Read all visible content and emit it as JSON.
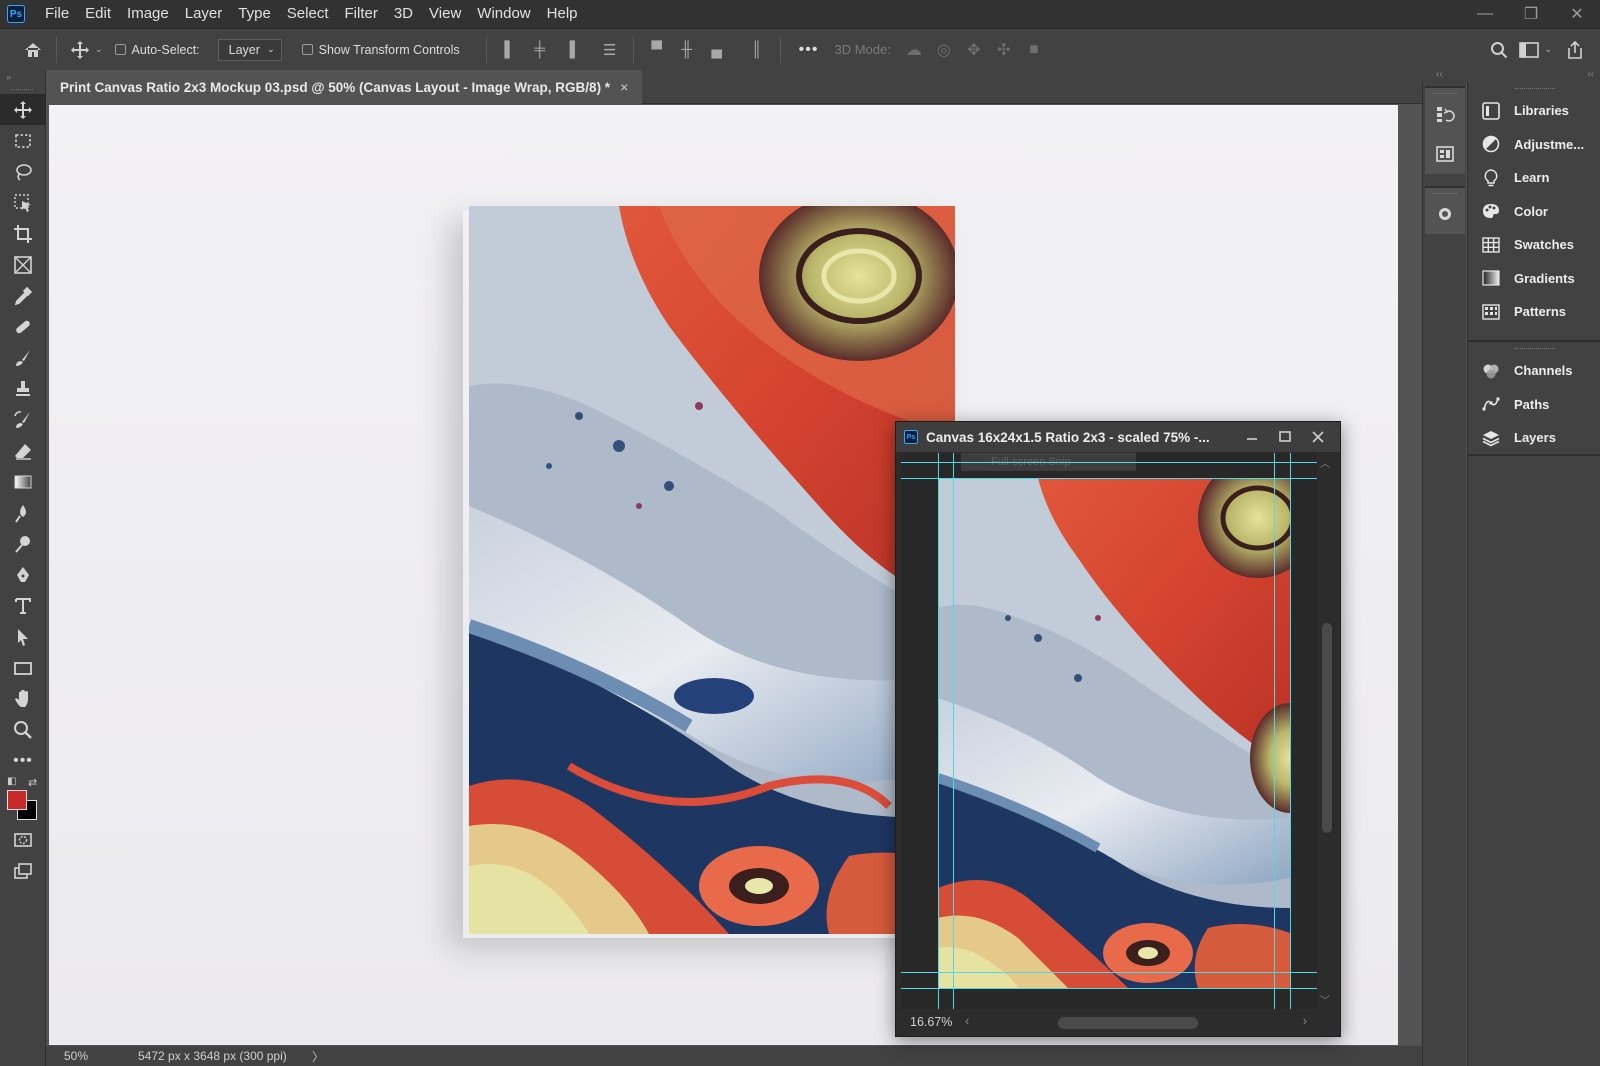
{
  "app": {
    "logo_text": "Ps"
  },
  "menu": [
    "File",
    "Edit",
    "Image",
    "Layer",
    "Type",
    "Select",
    "Filter",
    "3D",
    "View",
    "Window",
    "Help"
  ],
  "window_controls": {
    "minimize": "—",
    "restore": "❐",
    "close": "✕"
  },
  "options_bar": {
    "auto_select_label": "Auto-Select:",
    "auto_select_target": "Layer",
    "show_transform_label": "Show Transform Controls",
    "more": "•••",
    "mode_label": "3D Mode:"
  },
  "document": {
    "tab_title": "Print Canvas Ratio 2x3 Mockup 03.psd @ 50% (Canvas Layout - Image Wrap, RGB/8) *",
    "tab_close": "×"
  },
  "status": {
    "zoom": "50%",
    "dimensions": "5472 px x 3648 px (300 ppi)",
    "arrow": "〉"
  },
  "floating_window": {
    "logo_text": "Ps",
    "title": "Canvas 16x24x1.5 Ratio 2x3 - scaled 75% -...",
    "zoom": "16.67%",
    "ghost_tooltip": "Full-screen Snip"
  },
  "panels": {
    "group1": [
      "Libraries",
      "Adjustme...",
      "Learn",
      "Color",
      "Swatches",
      "Gradients",
      "Patterns"
    ],
    "group2": [
      "Channels",
      "Paths",
      "Layers"
    ]
  },
  "colors": {
    "foreground": "#c82a2a",
    "background": "#000000",
    "guides": "#4fd8e6"
  }
}
